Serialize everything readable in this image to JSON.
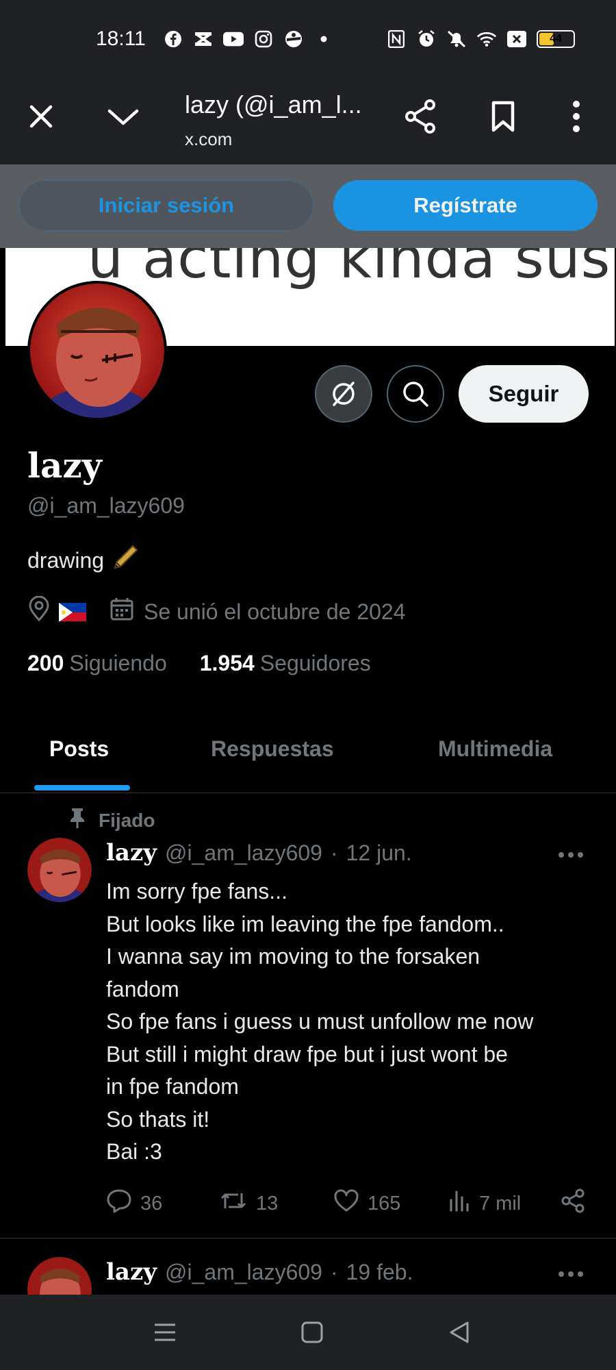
{
  "status_bar": {
    "time": "18:11",
    "left_icons": [
      "facebook-icon",
      "capcut-icon",
      "youtube-icon",
      "instagram-icon",
      "roblox-icon",
      "dot-icon"
    ],
    "right_icons": [
      "nfc-icon",
      "alarm-icon",
      "mute-icon",
      "wifi-icon",
      "sim-icon"
    ],
    "battery": "44",
    "battery_level_percent": 44
  },
  "browser": {
    "title": "lazy (@i_am_l...",
    "url": "x.com",
    "icons": [
      "close-icon",
      "chevron-down-icon",
      "share-icon",
      "bookmark-icon",
      "more-vertical-icon"
    ]
  },
  "login_bar": {
    "login_label": "Iniciar sesión",
    "register_label": "Regístrate"
  },
  "profile": {
    "banner_text": "u acting kinda sus",
    "name": "lazy",
    "handle": "@i_am_lazy609",
    "bio": "drawing",
    "bio_emoji": "pen-icon",
    "joined": "Se unió el octubre de 2024",
    "following_count": "200",
    "following_label": "Siguiendo",
    "followers_count": "1.954",
    "followers_label": "Seguidores",
    "follow_label": "Seguir"
  },
  "tabs": [
    {
      "label": "Posts",
      "active": true
    },
    {
      "label": "Respuestas",
      "active": false
    },
    {
      "label": "Multimedia",
      "active": false
    }
  ],
  "posts": [
    {
      "pinned_label": "Fijado",
      "name": "lazy",
      "handle": "@i_am_lazy609",
      "sep": "·",
      "date": "12 jun.",
      "lines": [
        "Im sorry fpe fans...",
        "But looks like im leaving the fpe fandom..",
        "I wanna say im moving to the forsaken",
        "fandom",
        "So fpe fans i guess u must unfollow me now",
        "But still i might draw fpe but i just wont be",
        "in fpe fandom",
        "So thats it!",
        "Bai :3"
      ],
      "replies": "36",
      "reposts": "13",
      "likes": "165",
      "views": "7 mil"
    },
    {
      "name": "lazy",
      "handle": "@i_am_lazy609",
      "sep": "·",
      "date": "19 feb."
    }
  ],
  "colors": {
    "accent": "#1d9bf0",
    "background": "#000000",
    "muted": "#71767b",
    "chrome": "#202124"
  }
}
